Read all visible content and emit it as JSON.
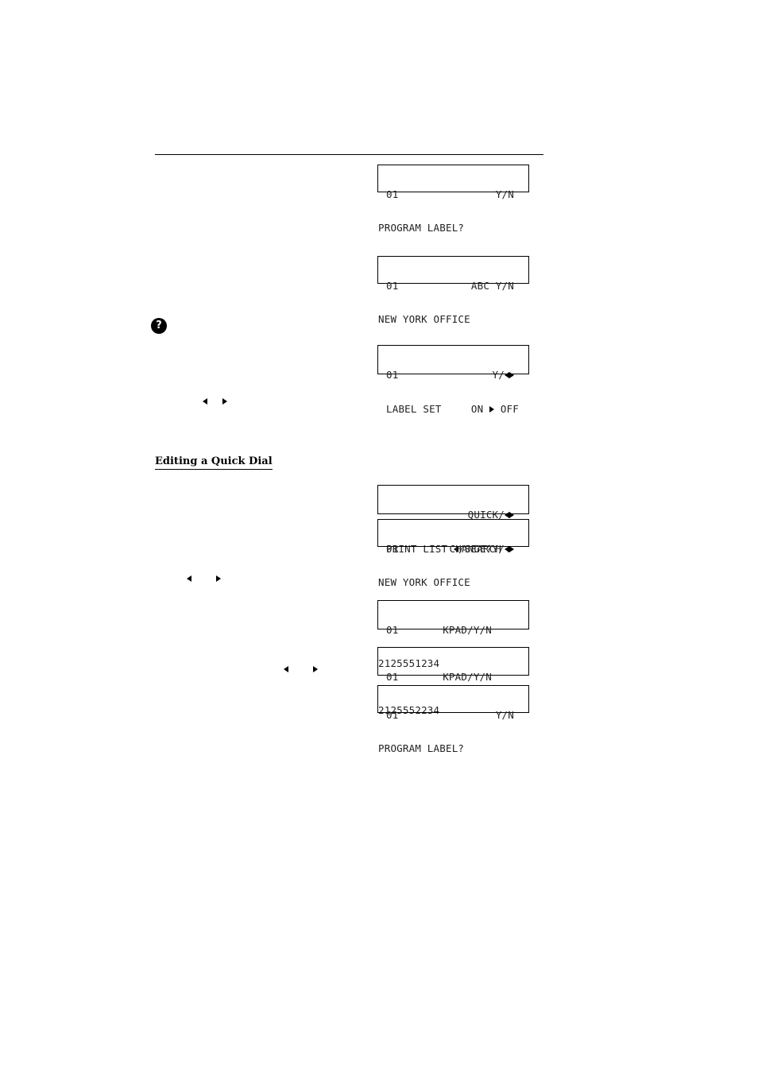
{
  "section_heading": "Editing a Quick Dial",
  "help_icon": "question-mark-icon",
  "displays": [
    {
      "line1_left": "01",
      "line1_right": "Y/N",
      "line2": "PROGRAM LABEL?"
    },
    {
      "line1_left": "01",
      "line1_right": "ABC Y/N",
      "line2": "NEW YORK OFFICE"
    },
    {
      "line1_left": "01",
      "line1_right": "Y/",
      "line2_left": "LABEL SET",
      "line2_on": "ON",
      "line2_off": "OFF"
    },
    {
      "line1_right": "QUICK/",
      "line2_a": "PRINT LIST ",
      "line2_b": "/SEARCH "
    },
    {
      "line1_left": "01",
      "line1_right": "CHANGE?Y/",
      "line2": "NEW YORK OFFICE"
    },
    {
      "line1_left": "01",
      "line1_right": "KPAD/Y/N",
      "line2": "2125551234"
    },
    {
      "line1_left": "01",
      "line1_right": "KPAD/Y/N",
      "line2": "2125552234"
    },
    {
      "line1_left": "01",
      "line1_right": "Y/N",
      "line2": "PROGRAM LABEL?"
    }
  ]
}
